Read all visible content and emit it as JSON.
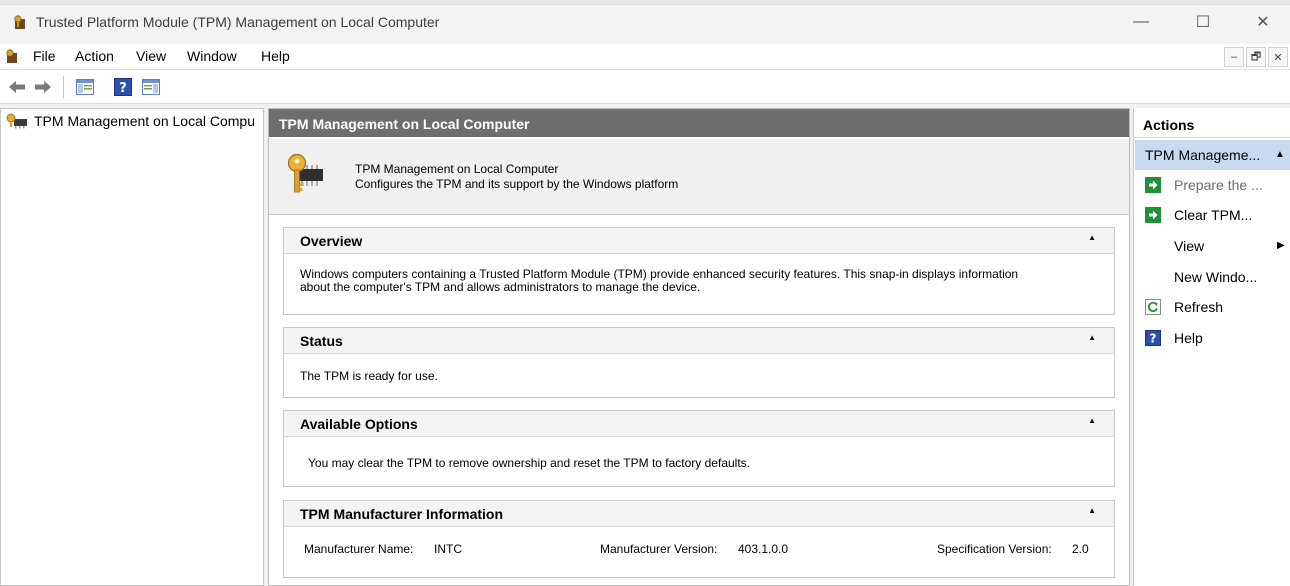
{
  "window": {
    "title": "Trusted Platform Module (TPM) Management on Local Computer",
    "controls": {
      "minimize": "—",
      "maximize": "☐",
      "close": "✕"
    }
  },
  "menu": {
    "items": [
      "File",
      "Action",
      "View",
      "Window",
      "Help"
    ],
    "mdi": {
      "minimize": "–",
      "restore": "🗗",
      "close": "✕"
    }
  },
  "toolbar": {
    "back_icon": "back-arrow-icon",
    "forward_icon": "forward-arrow-icon",
    "show_tree_icon": "show-hide-console-tree-icon",
    "help_icon": "help-icon",
    "show_action_pane_icon": "show-hide-action-pane-icon"
  },
  "tree": {
    "items": [
      {
        "label": "TPM Management on Local Compu",
        "icon": "tpm-snapin-icon"
      }
    ]
  },
  "center": {
    "header": "TPM Management on Local Computer",
    "snapin": {
      "title": "TPM Management on Local Computer",
      "description": "Configures the TPM and its support by the Windows platform"
    },
    "sections": {
      "overview": {
        "title": "Overview",
        "line1": "Windows computers containing a Trusted Platform Module (TPM) provide enhanced security features. This snap-in displays information",
        "line2": "about the computer's TPM and allows administrators to manage the device."
      },
      "status": {
        "title": "Status",
        "text": "The TPM is ready for use."
      },
      "available_options": {
        "title": "Available Options",
        "text": "You may clear the TPM to remove ownership and reset the TPM to factory defaults."
      },
      "manufacturer": {
        "title": "TPM Manufacturer Information",
        "manufacturer_name_label": "Manufacturer Name:",
        "manufacturer_name": "INTC",
        "manufacturer_version_label": "Manufacturer Version:",
        "manufacturer_version": "403.1.0.0",
        "specification_version_label": "Specification Version:",
        "specification_version": "2.0"
      }
    }
  },
  "actions": {
    "header": "Actions",
    "group": "TPM Manageme...",
    "items": [
      {
        "label": "Prepare the ...",
        "icon": "green-run-icon",
        "disabled": true
      },
      {
        "label": "Clear TPM...",
        "icon": "green-run-icon",
        "disabled": false
      },
      {
        "label": "View",
        "icon": "",
        "disabled": false,
        "submenu": true
      },
      {
        "label": "New Windo...",
        "icon": "",
        "disabled": false
      },
      {
        "label": "Refresh",
        "icon": "refresh-icon",
        "disabled": false
      },
      {
        "label": "Help",
        "icon": "help-icon",
        "disabled": false
      }
    ]
  },
  "colors": {
    "center_header_bg": "#6e6e6e",
    "actions_selected_bg": "#c7daf0",
    "green_action": "#1f8f3a",
    "help_blue": "#2f4fb0"
  }
}
